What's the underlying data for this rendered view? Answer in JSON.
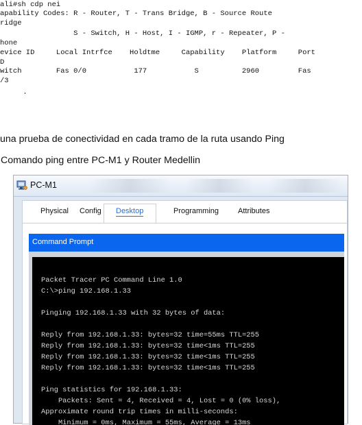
{
  "cli_output": {
    "lines": [
      "ali#sh cdp nei",
      "apability Codes: R - Router, T - Trans Bridge, B - Source Route",
      "ridge",
      "                 S - Switch, H - Host, I - IGMP, r - Repeater, P -",
      "hone",
      "evice ID     Local Intrfce    Holdtme     Capability    Platform     Port",
      "D",
      "witch        Fas 0/0           177           S          2960         Fas",
      "/3"
    ]
  },
  "document": {
    "paragraph": "una prueba de conectividad en cada tramo de la ruta usando Ping",
    "caption": "Comando ping entre PC-M1 y Router Medellin"
  },
  "pt_window": {
    "title": "PC-M1",
    "tabs": [
      "Physical",
      "Config",
      "Desktop",
      "Programming",
      "Attributes"
    ],
    "active_tab": "Desktop",
    "panel_title": "Command Prompt",
    "console_lines": [
      "Packet Tracer PC Command Line 1.0",
      "C:\\>ping 192.168.1.33",
      "",
      "Pinging 192.168.1.33 with 32 bytes of data:",
      "",
      "Reply from 192.168.1.33: bytes=32 time=55ms TTL=255",
      "Reply from 192.168.1.33: bytes=32 time<1ms TTL=255",
      "Reply from 192.168.1.33: bytes=32 time<1ms TTL=255",
      "Reply from 192.168.1.33: bytes=32 time<1ms TTL=255",
      "",
      "Ping statistics for 192.168.1.33:",
      "    Packets: Sent = 4, Received = 4, Lost = 0 (0% loss),",
      "Approximate round trip times in milli-seconds:",
      "    Minimum = 0ms, Maximum = 55ms, Average = 13ms"
    ]
  },
  "colors": {
    "accent_tab": "#2f6fd0",
    "command_bar": "#0a66ee",
    "console_bg": "#000000",
    "console_text": "#d8d8d8"
  },
  "icons": {
    "window_icon": "pc-monitor-icon"
  }
}
